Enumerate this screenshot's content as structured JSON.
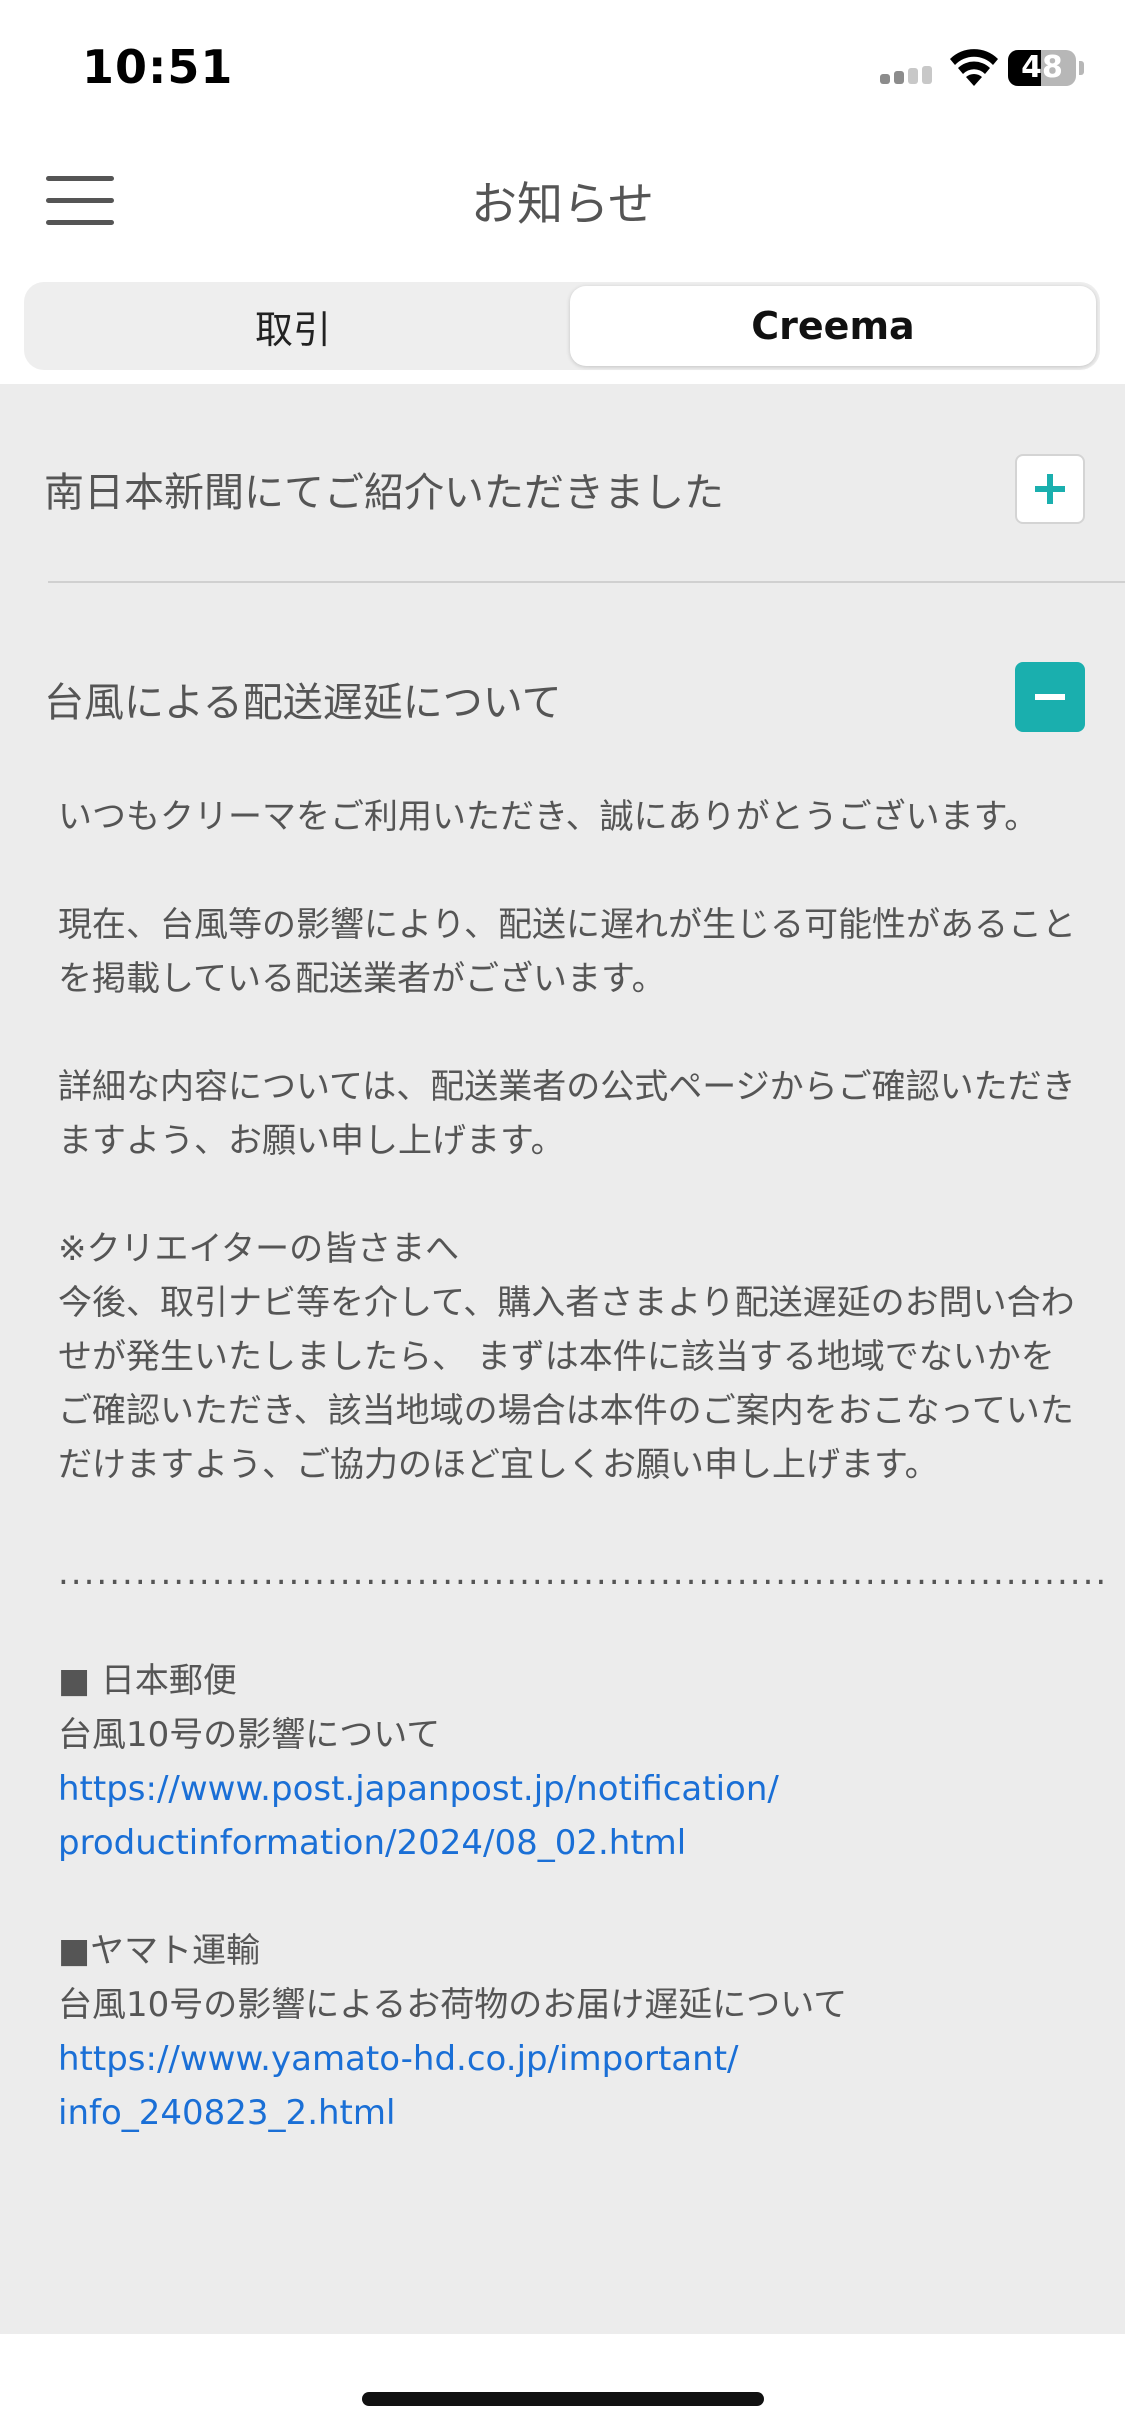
{
  "status_bar": {
    "time": "10:51",
    "battery_level": "48"
  },
  "header": {
    "title": "お知らせ"
  },
  "tabs": [
    {
      "label": "取引",
      "selected": false
    },
    {
      "label": "Creema",
      "selected": true
    }
  ],
  "notices": [
    {
      "title": "南日本新聞にてご紹介いただきました",
      "expanded": false
    },
    {
      "title": "台風による配送遅延について",
      "expanded": true,
      "body": {
        "p1": "いつもクリーマをご利用いただき、誠にありがとうございます。",
        "p2": "現在、台風等の影響により、配送に遅れが生じる可能性があることを掲載している配送業者がございます。",
        "p3": "詳細な内容については、配送業者の公式ページからご確認いただきますよう、お願い申し上げます。",
        "p4_head": "※クリエイターの皆さまへ",
        "p4_body": "今後、取引ナビ等を介して、購入者さまより配送遅延のお問い合わせが発生いたしましたら、 まずは本件に該当する地域でないかをご確認いただき、該当地域の場合は本件のご案内をおこなっていただけますよう、ご協力のほど宜しくお願い申し上げます。",
        "dots": "..................................................................................",
        "carrier1_name": "■ 日本郵便",
        "carrier1_desc": "台風10号の影響について",
        "carrier1_link_a": "https://www.post.japanpost.jp/notification/",
        "carrier1_link_b": "productinformation/2024/08_02.html",
        "carrier2_name": "■ヤマト運輸",
        "carrier2_desc": "台風10号の影響によるお荷物のお届け遅延について",
        "carrier2_link_a": "https://www.yamato-hd.co.jp/important/",
        "carrier2_link_b": "info_240823_2.html"
      }
    }
  ],
  "colors": {
    "accent": "#1aafae",
    "link": "#1a6fd6",
    "background": "#ececec"
  }
}
